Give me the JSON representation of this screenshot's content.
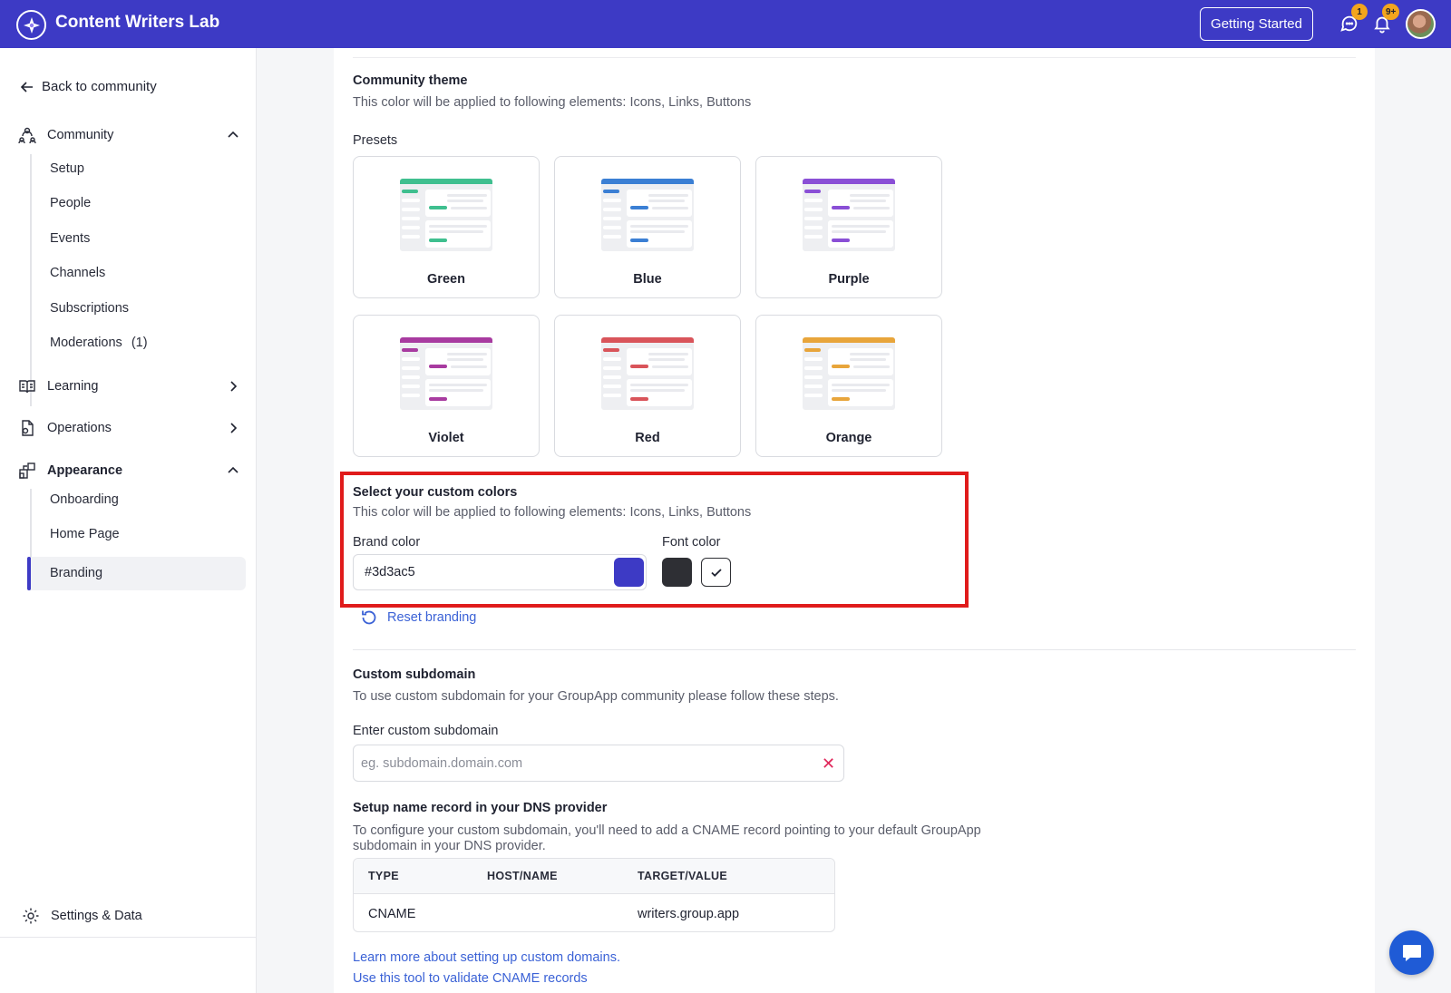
{
  "app": {
    "title": "Content Writers Lab"
  },
  "topbar": {
    "getting_started": "Getting Started",
    "messages_badge": "1",
    "notifications_badge": "9+"
  },
  "sidebar": {
    "back": "Back to community",
    "community": {
      "label": "Community",
      "items": [
        "Setup",
        "People",
        "Events",
        "Channels",
        "Subscriptions",
        "Moderations"
      ],
      "moderations_count": "(1)"
    },
    "learning": "Learning",
    "operations": "Operations",
    "appearance": {
      "label": "Appearance",
      "items": [
        "Onboarding",
        "Home Page",
        "Branding"
      ],
      "active": "Branding"
    },
    "settings": "Settings & Data"
  },
  "theme": {
    "title": "Community theme",
    "description": "This color will be applied to following elements: Icons, Links, Buttons",
    "presets_label": "Presets",
    "presets": [
      {
        "name": "Green",
        "color": "#3fbf8f"
      },
      {
        "name": "Blue",
        "color": "#3b7fd4"
      },
      {
        "name": "Purple",
        "color": "#8a4fd6"
      },
      {
        "name": "Violet",
        "color": "#a83ba0"
      },
      {
        "name": "Red",
        "color": "#d9545a"
      },
      {
        "name": "Orange",
        "color": "#e8a53b"
      }
    ]
  },
  "custom_colors": {
    "title": "Select your custom colors",
    "description": "This color will be applied to following elements: Icons, Links, Buttons",
    "brand_label": "Brand color",
    "brand_value": "#3d3ac5",
    "font_label": "Font color",
    "font_value": "#2e2f34",
    "reset": "Reset branding"
  },
  "subdomain": {
    "title": "Custom subdomain",
    "description": "To use custom subdomain for your GroupApp community please follow these steps.",
    "input_label": "Enter custom subdomain",
    "placeholder": "eg. subdomain.domain.com"
  },
  "dns": {
    "title": "Setup name record in your DNS provider",
    "description_line1": "To configure your custom subdomain, you'll need to add a CNAME record pointing to your default GroupApp",
    "description_line2": "subdomain in your DNS provider.",
    "headers": [
      "TYPE",
      "HOST/NAME",
      "TARGET/VALUE"
    ],
    "row": {
      "type": "CNAME",
      "host": "",
      "target": "writers.group.app"
    }
  },
  "links": {
    "learn_more": "Learn more about setting up custom domains.",
    "validate": "Use this tool to validate CNAME records"
  }
}
